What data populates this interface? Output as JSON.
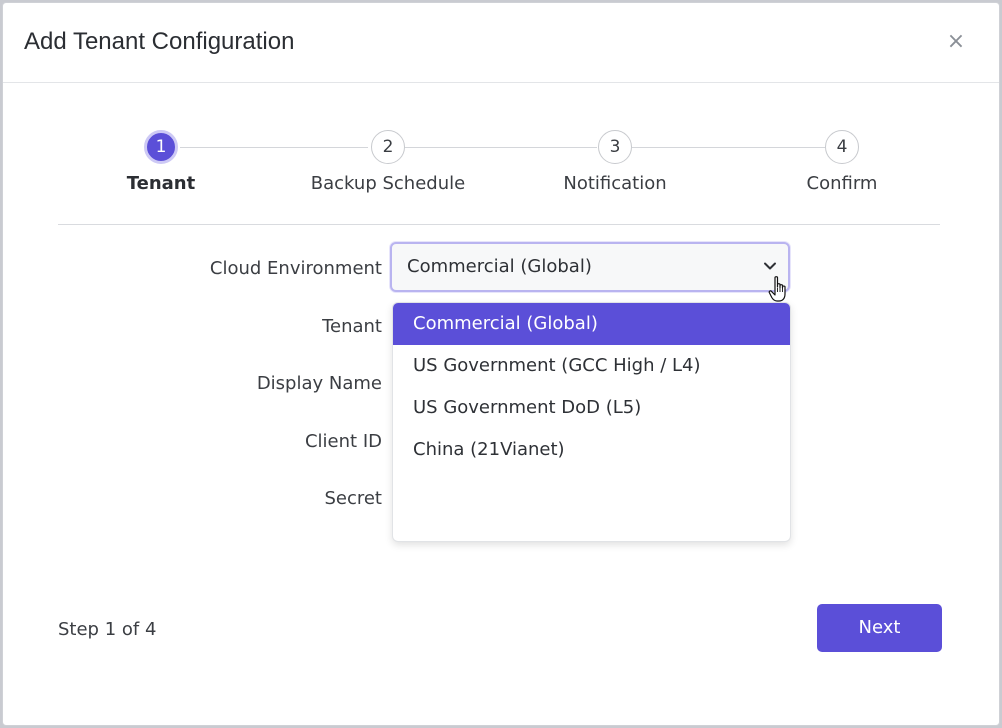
{
  "modal": {
    "title": "Add Tenant Configuration",
    "close_label": "×"
  },
  "stepper": {
    "steps": [
      {
        "number": "1",
        "label": "Tenant",
        "active": true
      },
      {
        "number": "2",
        "label": "Backup Schedule",
        "active": false
      },
      {
        "number": "3",
        "label": "Notification",
        "active": false
      },
      {
        "number": "4",
        "label": "Confirm",
        "active": false
      }
    ]
  },
  "form": {
    "labels": {
      "cloud_environment": "Cloud Environment",
      "tenant": "Tenant",
      "display_name": "Display Name",
      "client_id": "Client ID",
      "secret": "Secret"
    },
    "cloud_environment": {
      "selected": "Commercial (Global)",
      "options": [
        "Commercial (Global)",
        "US Government (GCC High / L4)",
        "US Government DoD (L5)",
        "China (21Vianet)"
      ]
    }
  },
  "footer": {
    "step_count": "Step 1 of 4",
    "next_label": "Next"
  },
  "colors": {
    "accent": "#5b4fd8",
    "focus_ring": "#b9b4f0"
  },
  "icons": {
    "close": "close-icon",
    "chevron": "chevron-down-icon",
    "cursor": "hand-pointer-icon"
  }
}
